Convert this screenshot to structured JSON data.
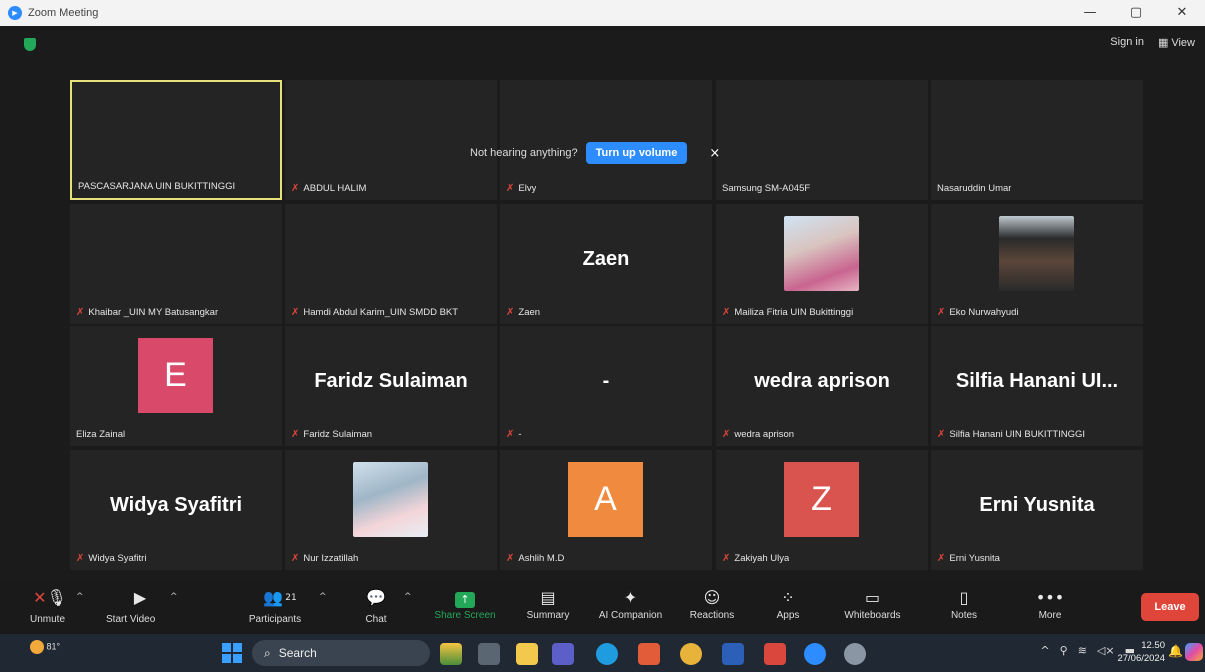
{
  "window": {
    "title": "Zoom Meeting",
    "controls": [
      "—",
      "▢",
      "✕"
    ]
  },
  "header": {
    "sign_in": "Sign in",
    "view": "View"
  },
  "banner": {
    "text": "Not hearing anything?",
    "button": "Turn up volume",
    "close": "×"
  },
  "tiles": [
    {
      "label": "PASCASARJANA UIN BUKITTINGGI",
      "muted": false,
      "active": true
    },
    {
      "label": "ABDUL HALIM",
      "muted": true
    },
    {
      "label": "Elvy",
      "muted": true
    },
    {
      "label": "Samsung SM-A045F",
      "muted": false
    },
    {
      "label": "Nasaruddin Umar",
      "muted": false
    },
    {
      "label": "Khaibar _UIN MY Batusangkar",
      "muted": true
    },
    {
      "label": "Hamdi Abdul Karim_UIN SMDD BKT",
      "muted": true
    },
    {
      "label": "Zaen",
      "muted": true,
      "bigname": "Zaen"
    },
    {
      "label": "Mailiza Fitria UIN Bukittinggi",
      "muted": true
    },
    {
      "label": "Eko Nurwahyudi",
      "muted": true
    },
    {
      "label": "Eliza Zainal",
      "muted": false,
      "avatar": "E"
    },
    {
      "label": "Faridz Sulaiman",
      "muted": true,
      "bigname": "Faridz Sulaiman"
    },
    {
      "label": "-",
      "muted": true,
      "bigname": "-"
    },
    {
      "label": "wedra aprison",
      "muted": true,
      "bigname": "wedra aprison"
    },
    {
      "label": "Silfia Hanani UIN BUKITTINGGI",
      "muted": true,
      "bigname": "Silfia Hanani UI..."
    },
    {
      "label": "Widya Syafitri",
      "muted": true,
      "bigname": "Widya Syafitri"
    },
    {
      "label": "Nur Izzatillah",
      "muted": true
    },
    {
      "label": "Ashlih M.D",
      "muted": true,
      "avatar": "A"
    },
    {
      "label": "Zakiyah Ulya",
      "muted": true,
      "avatar": "Z"
    },
    {
      "label": "Erni Yusnita",
      "muted": true,
      "bigname": "Erni Yusnita"
    }
  ],
  "colors": {
    "avatar_e": "#d94a6a",
    "avatar_a": "#f08a3e",
    "avatar_z": "#d9534f",
    "share_green": "#23a85a",
    "leave_red": "#e0453a",
    "zoom_blue": "#2d8cff"
  },
  "toolbar": {
    "unmute": "Unmute",
    "start_video": "Start Video",
    "participants": "Participants",
    "participants_count": "21",
    "chat": "Chat",
    "share_screen": "Share Screen",
    "summary": "Summary",
    "ai_companion": "AI Companion",
    "reactions": "Reactions",
    "apps": "Apps",
    "whiteboards": "Whiteboards",
    "notes": "Notes",
    "more": "More",
    "leave": "Leave"
  },
  "taskbar": {
    "weather": "81°",
    "search": "Search",
    "time": "12.50",
    "date": "27/06/2024"
  }
}
